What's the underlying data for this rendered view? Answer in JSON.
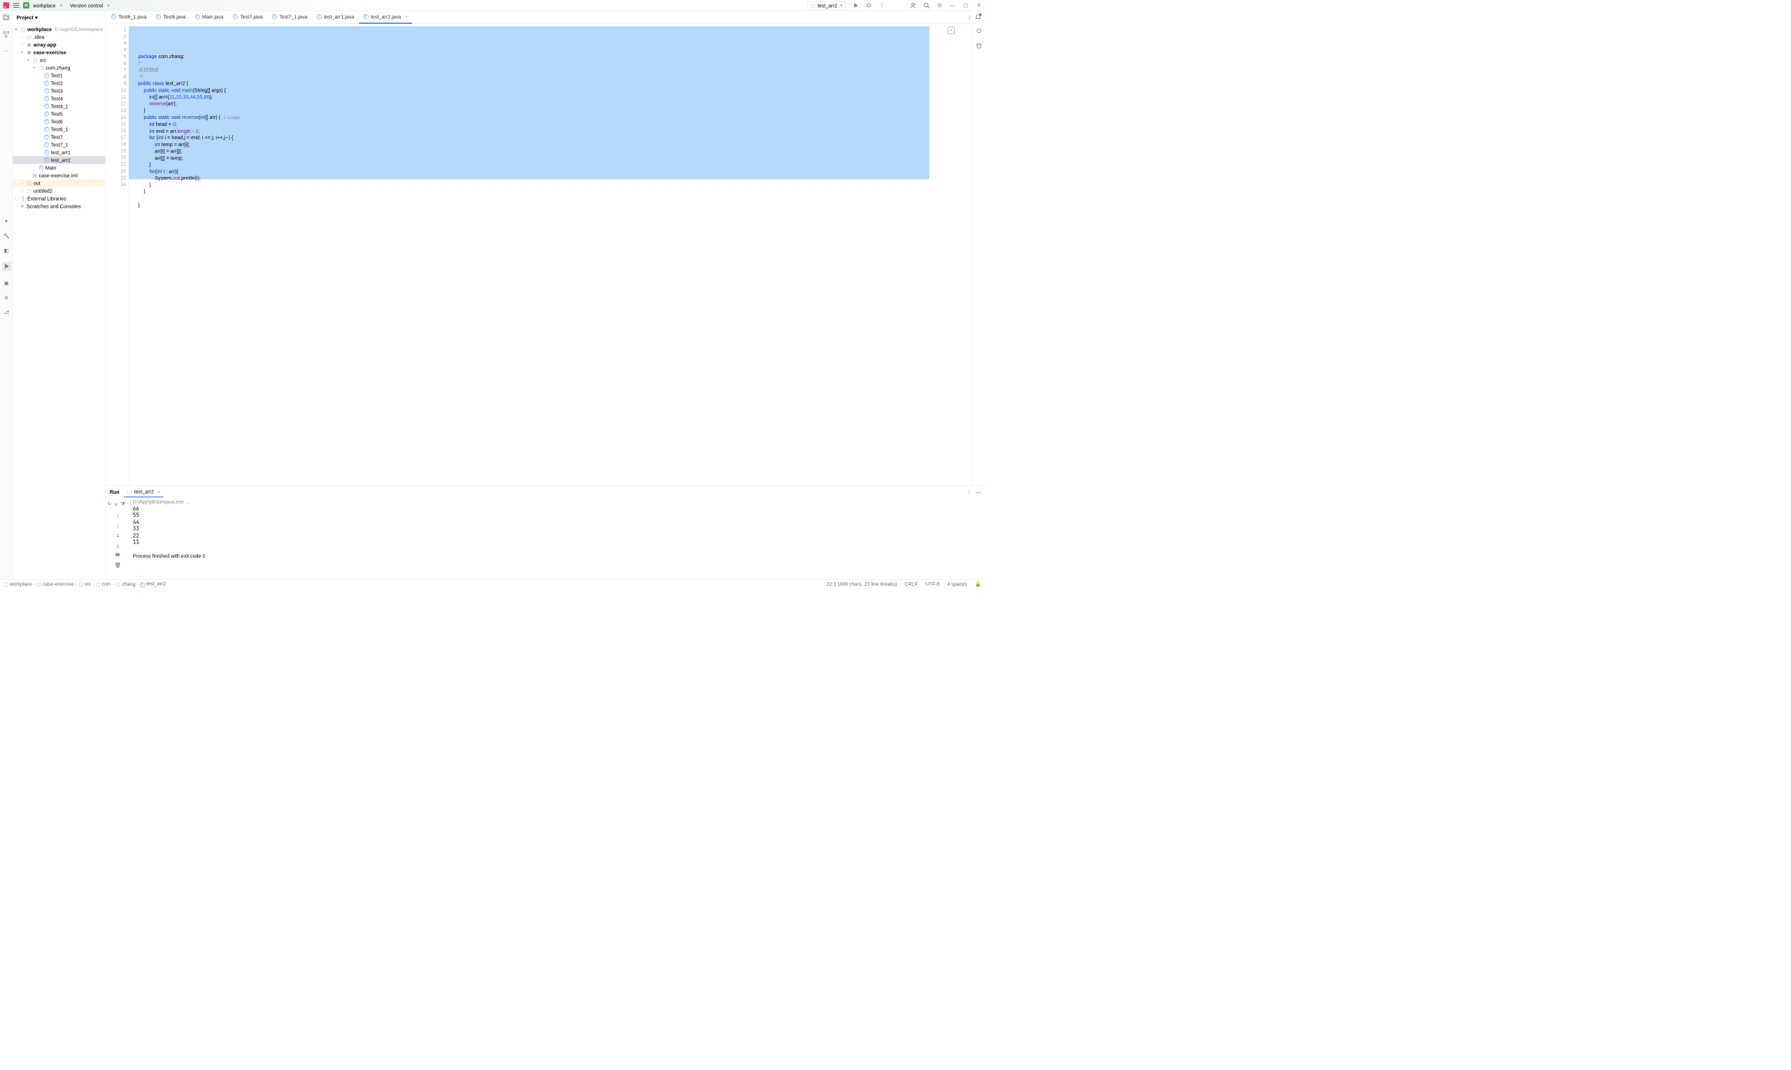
{
  "topbar": {
    "workspace": "workplace",
    "version_control": "Version control",
    "run_config": "test_arr2"
  },
  "project": {
    "title": "Project",
    "root_name": "workplace",
    "root_path": "D:\\App\\IDEA\\workplace",
    "nodes": {
      "idea": ".idea",
      "array_app": "array-app",
      "case_exercise": "case-exercise",
      "src": "src",
      "pkg": "com.zhang",
      "test1": "Test1",
      "test2": "Test2",
      "test3": "Test3",
      "test4": "Test4",
      "test4_1": "Test4_1",
      "test5": "Test5",
      "test6": "Test6",
      "test6_1": "Test6_1",
      "test7": "Test7",
      "test7_1": "Test7_1",
      "test_arr1": "test_arr1",
      "test_arr2": "test_arr2",
      "main": "Main",
      "iml": "case-exercise.iml",
      "out": "out",
      "untitled2": "untitled2",
      "ext_lib": "External Libraries",
      "scratches": "Scratches and Consoles"
    }
  },
  "tabs": [
    {
      "label": "Test6_1.java",
      "active": false
    },
    {
      "label": "Test6.java",
      "active": false
    },
    {
      "label": "Main.java",
      "active": false
    },
    {
      "label": "Test7.java",
      "active": false
    },
    {
      "label": "Test7_1.java",
      "active": false
    },
    {
      "label": "test_arr1.java",
      "active": false
    },
    {
      "label": "test_arr2.java",
      "active": true
    }
  ],
  "editor": {
    "line_count": 24,
    "run_marks": [
      5,
      6
    ],
    "at_marks": [
      10
    ]
  },
  "code_tokens": [
    [
      {
        "t": "package ",
        "c": "kw"
      },
      {
        "t": "com.zhang;",
        "c": ""
      }
    ],
    [
      {
        "t": "/*",
        "c": "cmt"
      }
    ],
    [
      {
        "t": "反转数组",
        "c": "cmt"
      }
    ],
    [
      {
        "t": " */",
        "c": "cmt"
      }
    ],
    [
      {
        "t": "public class ",
        "c": "kw"
      },
      {
        "t": "test_arr2 {",
        "c": ""
      }
    ],
    [
      {
        "t": "    public static void ",
        "c": "kw"
      },
      {
        "t": "main",
        "c": "fn"
      },
      {
        "t": "(String[] args) {",
        "c": ""
      }
    ],
    [
      {
        "t": "        int",
        "c": "kw"
      },
      {
        "t": "[] arr={",
        "c": ""
      },
      {
        "t": "11",
        "c": "num"
      },
      {
        "t": ",",
        "c": ""
      },
      {
        "t": "22",
        "c": "num"
      },
      {
        "t": ",",
        "c": ""
      },
      {
        "t": "33",
        "c": "num"
      },
      {
        "t": ",",
        "c": ""
      },
      {
        "t": "44",
        "c": "num"
      },
      {
        "t": ",",
        "c": ""
      },
      {
        "t": "55",
        "c": "num"
      },
      {
        "t": ",",
        "c": ""
      },
      {
        "t": "66",
        "c": "num"
      },
      {
        "t": "};",
        "c": ""
      }
    ],
    [
      {
        "t": "        reverse",
        "c": "fld"
      },
      {
        "t": "(arr);",
        "c": ""
      }
    ],
    [
      {
        "t": "    }",
        "c": ""
      }
    ],
    [
      {
        "t": "    public static void ",
        "c": "kw"
      },
      {
        "t": "reverse",
        "c": "fn"
      },
      {
        "t": "(",
        "c": ""
      },
      {
        "t": "int",
        "c": "kw"
      },
      {
        "t": "[] arr) {  ",
        "c": ""
      },
      {
        "t": "1 usage",
        "c": "usage-hint"
      }
    ],
    [
      {
        "t": "        int ",
        "c": "kw"
      },
      {
        "t": "head = ",
        "c": ""
      },
      {
        "t": "0",
        "c": "num"
      },
      {
        "t": ";",
        "c": ""
      }
    ],
    [
      {
        "t": "        int ",
        "c": "kw"
      },
      {
        "t": "end = arr.",
        "c": ""
      },
      {
        "t": "length",
        "c": "fld"
      },
      {
        "t": " - ",
        "c": ""
      },
      {
        "t": "1",
        "c": "num"
      },
      {
        "t": ";",
        "c": ""
      }
    ],
    [
      {
        "t": "        for ",
        "c": "kw"
      },
      {
        "t": "(",
        "c": ""
      },
      {
        "t": "int ",
        "c": "kw"
      },
      {
        "t": "i = head,j = end; i <= j; i++,j--) {",
        "c": ""
      }
    ],
    [
      {
        "t": "            int ",
        "c": "kw"
      },
      {
        "t": "temp = arr[i];",
        "c": ""
      }
    ],
    [
      {
        "t": "            arr[i] = arr[j];",
        "c": ""
      }
    ],
    [
      {
        "t": "            arr[j] = temp;",
        "c": ""
      }
    ],
    [
      {
        "t": "        }",
        "c": ""
      }
    ],
    [
      {
        "t": "        for",
        "c": "kw"
      },
      {
        "t": "(",
        "c": ""
      },
      {
        "t": "int ",
        "c": "kw"
      },
      {
        "t": "i : arr){",
        "c": ""
      }
    ],
    [
      {
        "t": "            System.",
        "c": ""
      },
      {
        "t": "out",
        "c": "fld"
      },
      {
        "t": ".println(i);",
        "c": ""
      }
    ],
    [
      {
        "t": "        }",
        "c": ""
      }
    ],
    [
      {
        "t": "    }",
        "c": ""
      }
    ],
    [
      {
        "t": "",
        "c": ""
      }
    ],
    [
      {
        "t": "}",
        "c": ""
      }
    ],
    [
      {
        "t": "",
        "c": ""
      }
    ]
  ],
  "run": {
    "title": "Run",
    "tab": "test_arr2",
    "output_cmd": "D:\\App\\jdk\\bin\\java.exe ...",
    "output_lines": [
      "66",
      "55",
      "44",
      "33",
      "22",
      "11"
    ],
    "exit_msg": "Process finished with exit code 0"
  },
  "breadcrumbs": [
    "workplace",
    "case-exercise",
    "src",
    "com",
    "zhang",
    "test_arr2"
  ],
  "status": {
    "pos": "22:1 (499 chars, 23 line breaks)",
    "eol": "CRLF",
    "enc": "UTF-8",
    "indent": "4 spaces"
  }
}
